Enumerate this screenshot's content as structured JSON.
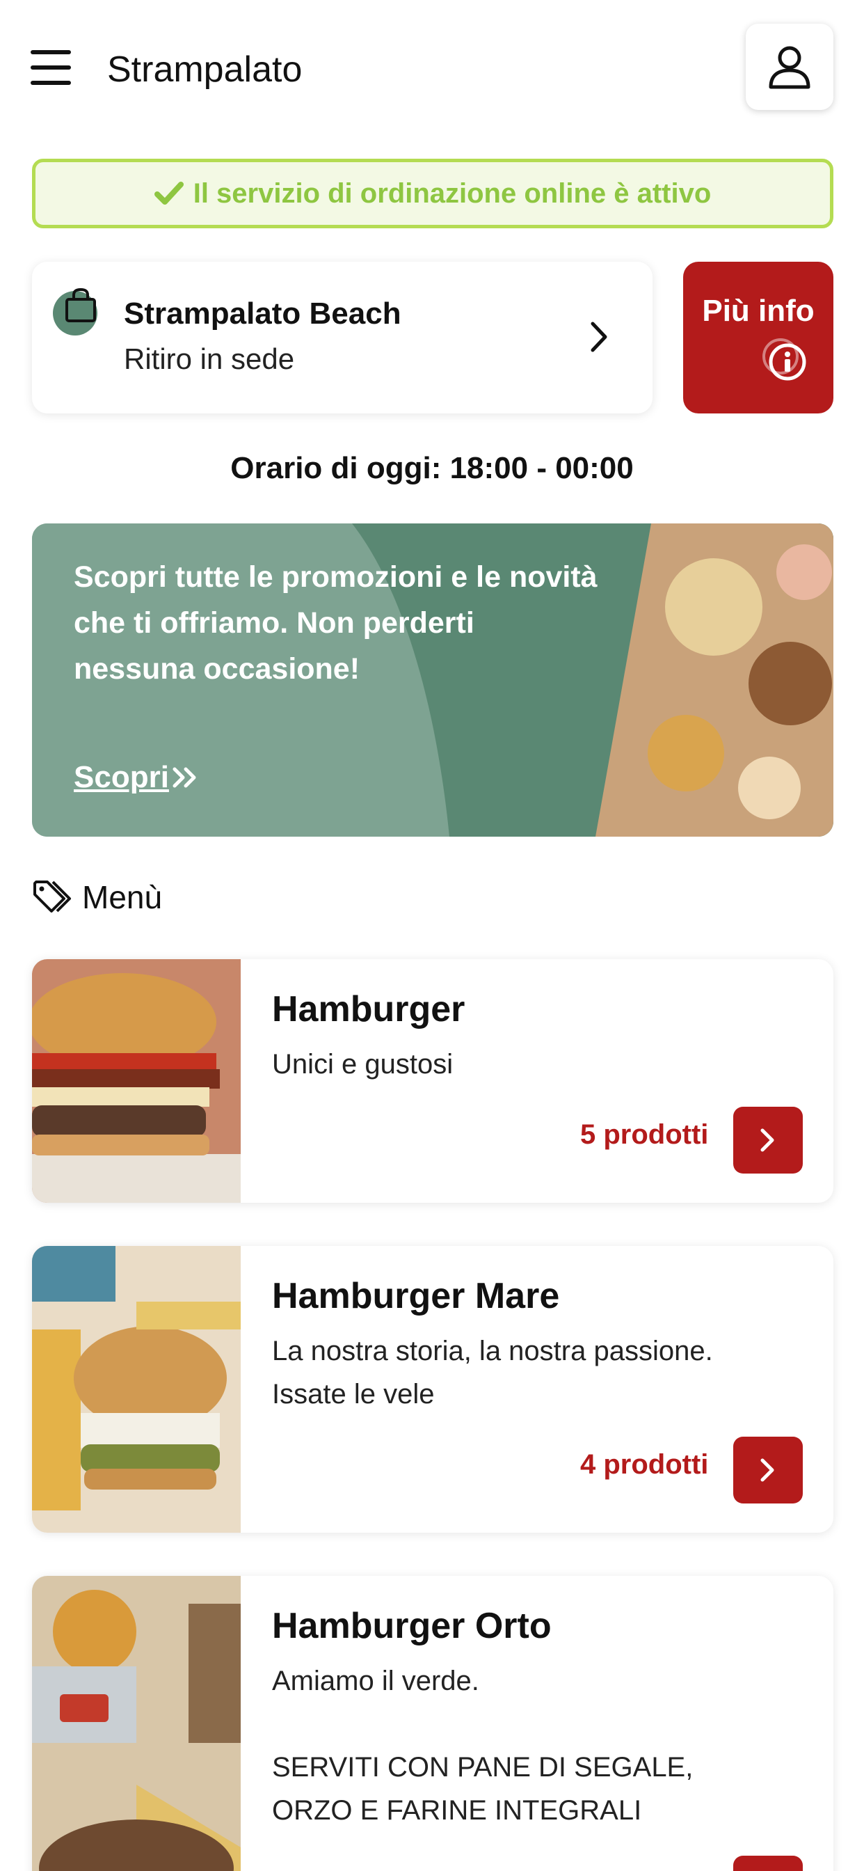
{
  "header": {
    "title": "Strampalato",
    "menu_icon": "hamburger-menu-icon",
    "profile_icon": "user-icon"
  },
  "status": {
    "text": "Il servizio di ordinazione online è attivo",
    "icon": "check-icon",
    "color": "#8ec641"
  },
  "store": {
    "name": "Strampalato Beach",
    "mode": "Ritiro in sede",
    "icon": "shopping-bag-icon"
  },
  "info_button": {
    "label": "Più info",
    "icon": "info-icon"
  },
  "hours": {
    "text": "Orario di oggi: 18:00 - 00:00"
  },
  "promo": {
    "text": "Scopri tutte le promozioni e le novità che ti offriamo. Non perderti nessuna occasione!",
    "link_label": "Scopri ",
    "link_icon": "double-chevron-right-icon"
  },
  "menu": {
    "heading": "Menù",
    "heading_icon": "tags-icon",
    "categories": [
      {
        "title": "Hamburger",
        "description": "Unici e gustosi",
        "count": "5 prodotti"
      },
      {
        "title": "Hamburger Mare",
        "description": "La nostra storia, la nostra passione.\nIssate le vele",
        "count": "4 prodotti"
      },
      {
        "title": "Hamburger Orto",
        "description": "Amiamo il verde.\n\nSERVITI CON PANE DI SEGALE,\nORZO E FARINE INTEGRALI",
        "count": ""
      }
    ]
  },
  "colors": {
    "brand_red": "#b31b1b",
    "brand_green": "#5a8873",
    "success_green": "#b4dc52"
  }
}
